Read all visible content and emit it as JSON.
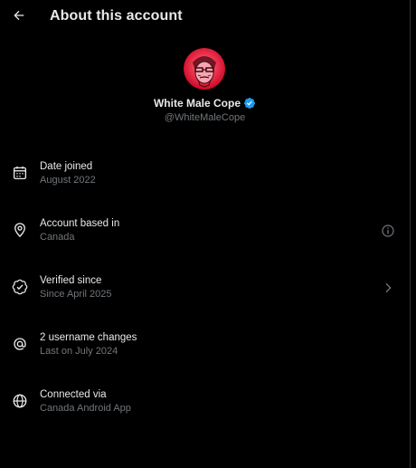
{
  "header": {
    "title": "About this account",
    "back_icon": "arrow-left-icon"
  },
  "profile": {
    "display_name": "White Male Cope",
    "handle": "@WhiteMaleCope",
    "verified": true,
    "badge_color": "#1d9bf0"
  },
  "details": [
    {
      "icon": "calendar-icon",
      "label": "Date joined",
      "value": "August 2022",
      "trailing": null
    },
    {
      "icon": "location-pin-icon",
      "label": "Account based in",
      "value": "Canada",
      "trailing": "info-icon"
    },
    {
      "icon": "verified-check-icon",
      "label": "Verified since",
      "value": "Since April 2025",
      "trailing": "chevron-right-icon"
    },
    {
      "icon": "at-sign-icon",
      "label": "2 username changes",
      "value": "Last on July 2024",
      "trailing": null
    },
    {
      "icon": "globe-icon",
      "label": "Connected via",
      "value": "Canada Android App",
      "trailing": null
    }
  ],
  "colors": {
    "background": "#000000",
    "primary_text": "#e7e9ea",
    "secondary_text": "#71767b",
    "accent": "#1d9bf0"
  }
}
